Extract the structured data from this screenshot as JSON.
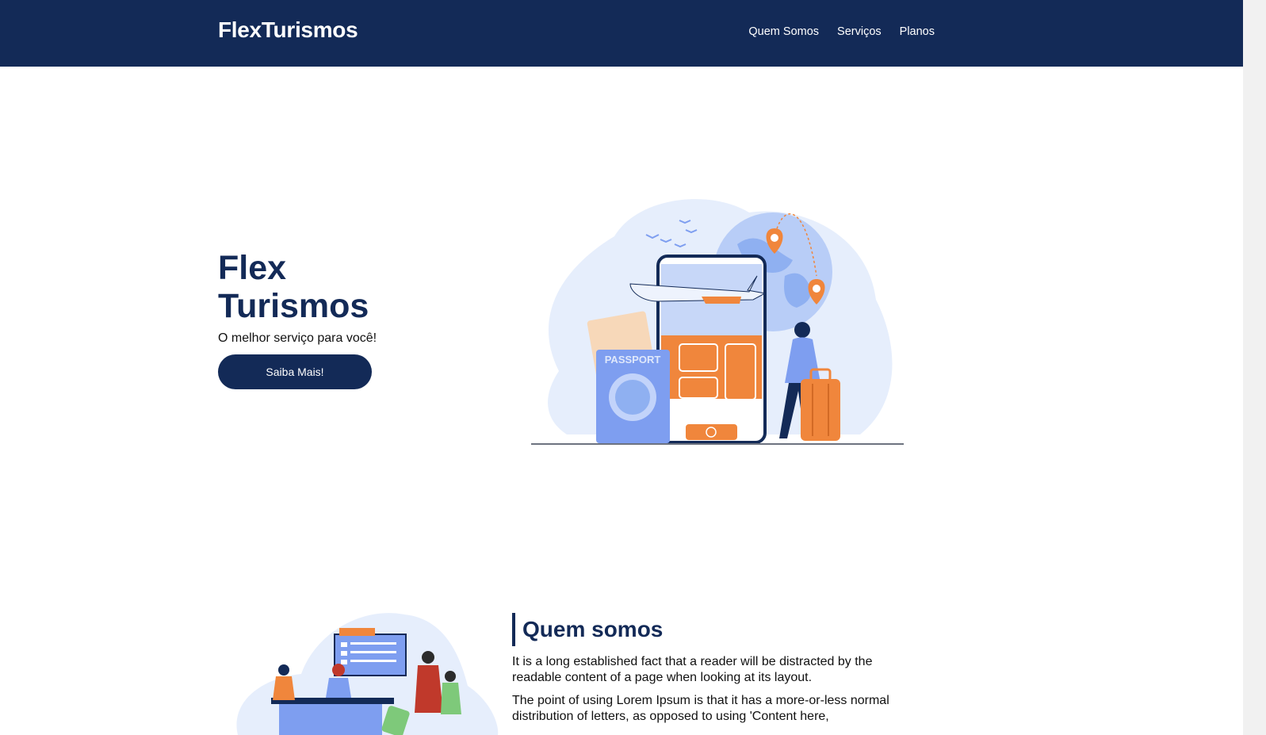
{
  "nav": {
    "brand": "FlexTurismos",
    "links": [
      "Quem Somos",
      "Serviços",
      "Planos"
    ]
  },
  "hero": {
    "title_line1": "Flex",
    "title_line2": "Turismos",
    "subtitle": "O melhor serviço para você!",
    "button_label": "Saiba Mais!",
    "illustration_text": "PASSPORT"
  },
  "about": {
    "title": "Quem somos",
    "paragraph1": "It is a long established fact that a reader will be distracted by the readable content of a page when looking at its layout.",
    "paragraph2": "The point of using Lorem Ipsum is that it has a more-or-less normal distribution of letters, as opposed to using 'Content here,"
  },
  "colors": {
    "primary": "#132a57",
    "accent": "#f0863c",
    "soft_blue": "#dfe8fb",
    "mid_blue": "#7e9ef0"
  }
}
